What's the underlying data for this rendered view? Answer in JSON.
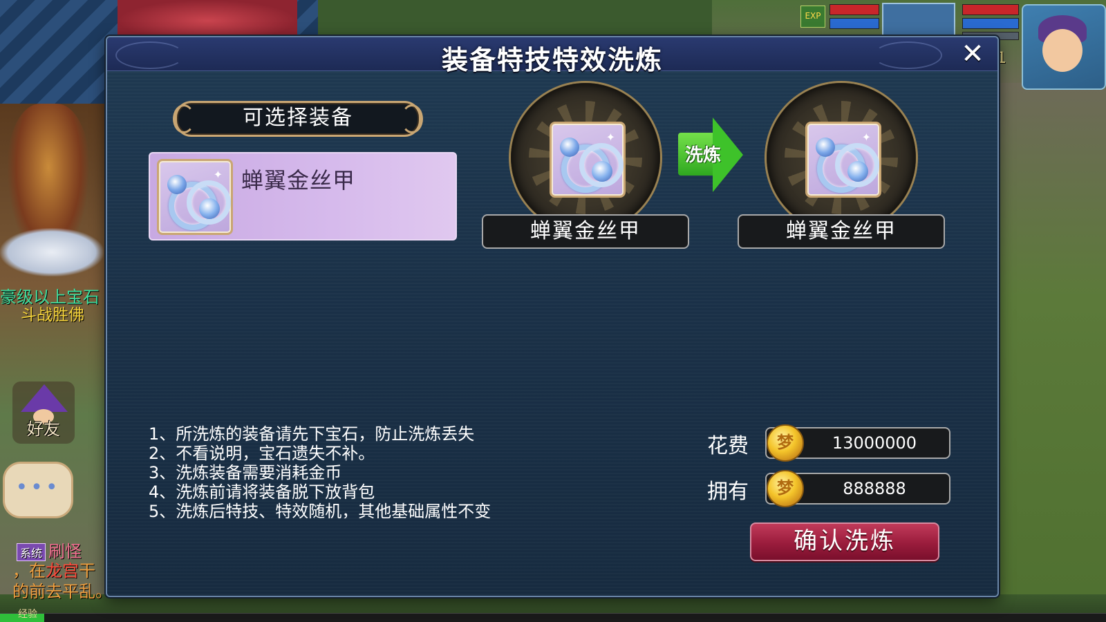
{
  "dialog": {
    "title": "装备特技特效洗炼",
    "close_glyph": "✕",
    "list_header": "可选择装备",
    "selected_item": {
      "name": "蝉翼金丝甲",
      "icon": "ring-icon"
    },
    "before_item": {
      "name": "蝉翼金丝甲",
      "icon": "ring-icon"
    },
    "after_item": {
      "name": "蝉翼金丝甲",
      "icon": "ring-icon"
    },
    "refine_arrow_label": "洗炼",
    "notes": [
      "1、所洗炼的装备请先下宝石，防止洗炼丢失",
      "2、不看说明，宝石遗失不补。",
      "3、洗炼装备需要消耗金币",
      "4、洗炼前请将装备脱下放背包",
      "5、洗炼后特技、特效随机，其他基础属性不变"
    ],
    "cost_label": "花费",
    "cost_value": "13000000",
    "owned_label": "拥有",
    "owned_value": "888888",
    "coin_icon": "coin-icon",
    "confirm_label": "确认洗炼"
  },
  "hud": {
    "left_notice_1": "豪级以上宝石",
    "left_notice_2": "斗战胜佛",
    "friend_label": "好友",
    "chat_button_glyph": "•••",
    "chat_tag": "系统",
    "chat_line_1": "刷怪",
    "chat_line_2_prefix": "，在",
    "chat_line_2_place": "龙宫",
    "chat_line_2_suffix": "干",
    "chat_line_3": "的前去平乱。",
    "exp_label": "经验",
    "exp_icon_text": "EXP",
    "level_text": "1"
  },
  "colors": {
    "modal_bg": "#1a3047",
    "header_bg": "#2a3a70",
    "item_bg": "#d6baec",
    "confirm_bg": "#9a1c3c",
    "arrow_green": "#3ec22a",
    "frame_gold": "#c9a673"
  }
}
